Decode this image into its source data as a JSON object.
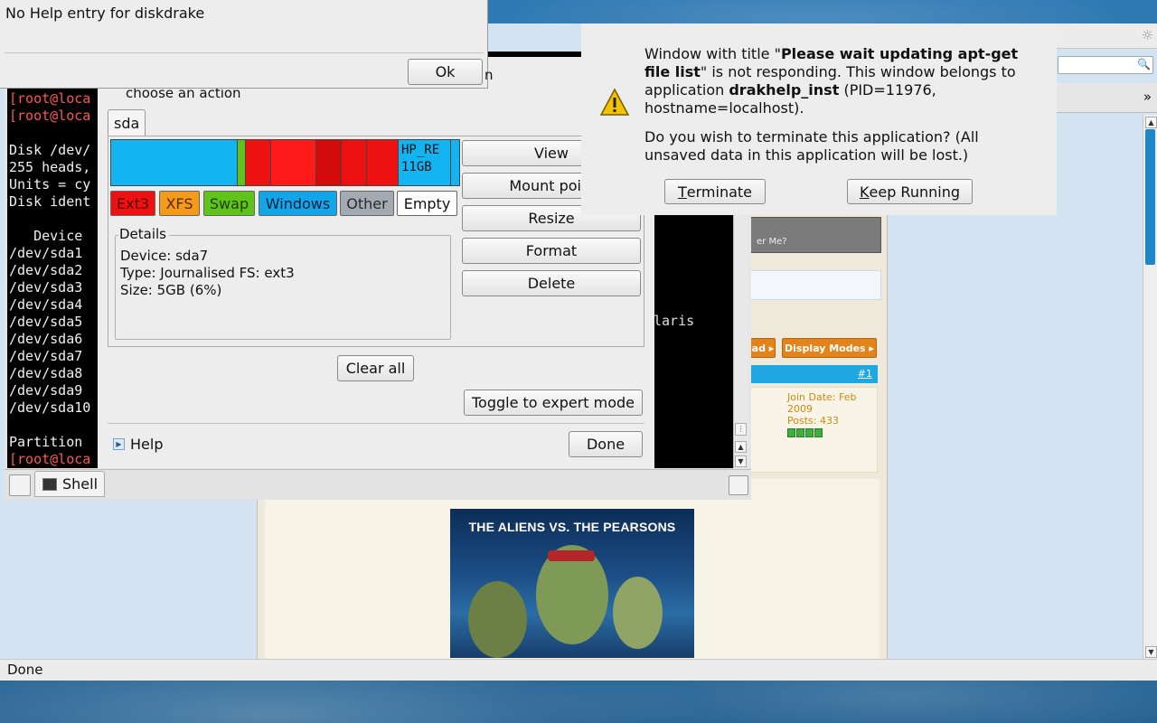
{
  "statusbar": {
    "text": "Done"
  },
  "browser": {
    "promo_text": "er Me?",
    "buttons": [
      "ad ▸",
      "Display Modes ▸"
    ],
    "post_number": "#1",
    "join_date": "Join Date: Feb 2009",
    "posts": "Posts: 433",
    "chevron": "»",
    "poster_title": "THE ALIENS VS. THE PEARSONS"
  },
  "help_popup": {
    "message": "No Help entry for diskdrake",
    "ok_label": "Ok",
    "behind_char": "n"
  },
  "terminal": {
    "lines": [
      {
        "text": "[root@loca",
        "red": true
      },
      {
        "text": "[root@loca",
        "red": true
      },
      {
        "text": "",
        "red": false
      },
      {
        "text": "Disk /dev/",
        "red": false
      },
      {
        "text": "255 heads,",
        "red": false
      },
      {
        "text": "Units = cy",
        "red": false
      },
      {
        "text": "Disk ident",
        "red": false
      },
      {
        "text": "",
        "red": false
      },
      {
        "text": "   Device",
        "red": false
      },
      {
        "text": "/dev/sda1",
        "red": false
      },
      {
        "text": "/dev/sda2",
        "red": false
      },
      {
        "text": "/dev/sda3",
        "red": false
      },
      {
        "text": "/dev/sda4",
        "red": false
      },
      {
        "text": "/dev/sda5",
        "red": false
      },
      {
        "text": "/dev/sda6",
        "red": false
      },
      {
        "text": "/dev/sda7",
        "red": false
      },
      {
        "text": "/dev/sda8",
        "red": false
      },
      {
        "text": "/dev/sda9",
        "red": false
      },
      {
        "text": "/dev/sda10",
        "red": false
      },
      {
        "text": "",
        "red": false
      },
      {
        "text": "Partition",
        "red": false
      },
      {
        "text": "[root@loca",
        "red": true
      }
    ],
    "right_text": "laris",
    "tab_label": "Shell"
  },
  "diskdrake": {
    "choose_action": "choose an action",
    "disk_tab": "sda",
    "partitions": [
      {
        "color": "#12b4f2",
        "label": ""
      },
      {
        "color": "#5fc31b",
        "label": ""
      },
      {
        "color": "#ee1111",
        "label": ""
      },
      {
        "color": "#ff1a1a",
        "label": ""
      },
      {
        "color": "#d40b0b",
        "label": ""
      },
      {
        "color": "#ee1111",
        "label": ""
      },
      {
        "color": "#ee1111",
        "label": ""
      },
      {
        "color": "#12b4f2",
        "label": "HP_RE\n11GB"
      },
      {
        "color": "#12b4f2",
        "label": ""
      }
    ],
    "legend": [
      {
        "label": "Ext3",
        "color": "#ee1111",
        "text_color": "#5a0000"
      },
      {
        "label": "XFS",
        "color": "#f39a1a",
        "text_color": "#5a2a00"
      },
      {
        "label": "Swap",
        "color": "#5fc31b",
        "text_color": "#1f3f00"
      },
      {
        "label": "Windows",
        "color": "#12a6e8",
        "text_color": "#00203a"
      },
      {
        "label": "Other",
        "color": "#a3aab2",
        "text_color": "#2a2a2a"
      },
      {
        "label": "Empty",
        "color": "#ffffff",
        "text_color": "#111111"
      }
    ],
    "actions": [
      "View",
      "Mount poi",
      "Resize",
      "Format",
      "Delete"
    ],
    "details": {
      "title": "Details",
      "device": "Device: sda7",
      "type": "Type: Journalised FS: ext3",
      "size": "Size: 5GB (6%)"
    },
    "clear_all": "Clear all",
    "toggle_expert": "Toggle to expert mode",
    "help": "Help",
    "done": "Done"
  },
  "not_responding": {
    "pre_title": "Window with title \"",
    "window_title": "Please wait updating apt-get file list",
    "mid1": "\" is not responding. This window belongs to application ",
    "app": "drakhelp_inst",
    "post": " (PID=11976, hostname=localhost).",
    "question": "Do you wish to terminate this application? (All unsaved data in this application will be lost.)",
    "terminate_mnemonic": "T",
    "terminate_rest": "erminate",
    "keep_mnemonic": "K",
    "keep_rest": "eep Running"
  },
  "colors": {
    "accent": "#1f86c8",
    "warning": "#f2c200"
  }
}
